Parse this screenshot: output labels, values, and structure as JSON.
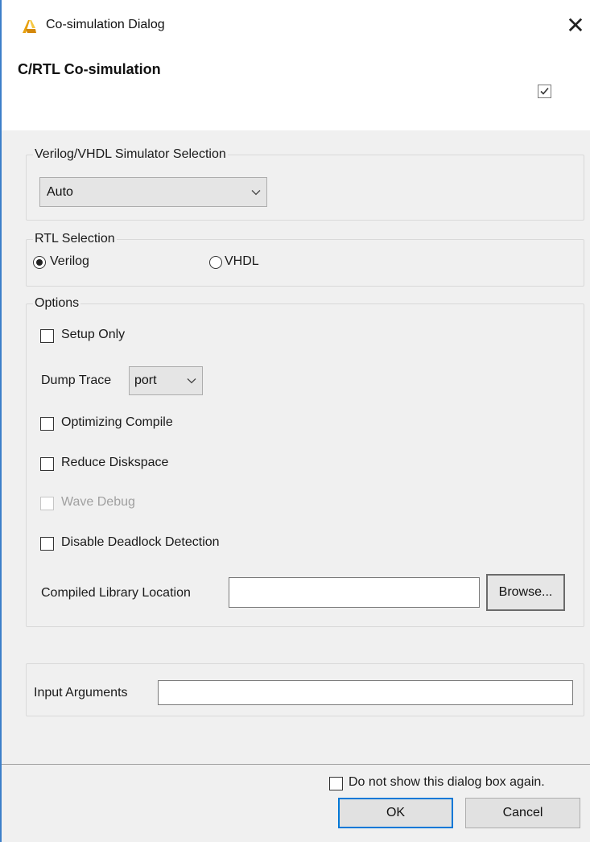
{
  "window": {
    "title": "Co-simulation Dialog",
    "icon": "xilinx-logo-icon",
    "accent_color": "#3c7fc9"
  },
  "header": {
    "title": "C/RTL Co-simulation",
    "checkbox_checked": true
  },
  "simulator": {
    "legend": "Verilog/VHDL Simulator Selection",
    "selected": "Auto"
  },
  "rtl": {
    "legend": "RTL Selection",
    "verilog_label": "Verilog",
    "vhdl_label": "VHDL",
    "selected": "Verilog"
  },
  "options": {
    "legend": "Options",
    "setup_only": "Setup Only",
    "dump_trace_label": "Dump Trace",
    "dump_trace_value": "port",
    "optimizing_compile": "Optimizing Compile",
    "reduce_diskspace": "Reduce Diskspace",
    "wave_debug": "Wave Debug",
    "disable_deadlock": "Disable Deadlock Detection",
    "compiled_lib_label": "Compiled Library Location",
    "compiled_lib_value": "",
    "browse_label": "Browse..."
  },
  "input_args": {
    "label": "Input Arguments",
    "value": ""
  },
  "footer": {
    "dont_show_label": "Do not show this dialog box again.",
    "ok_label": "OK",
    "cancel_label": "Cancel"
  }
}
